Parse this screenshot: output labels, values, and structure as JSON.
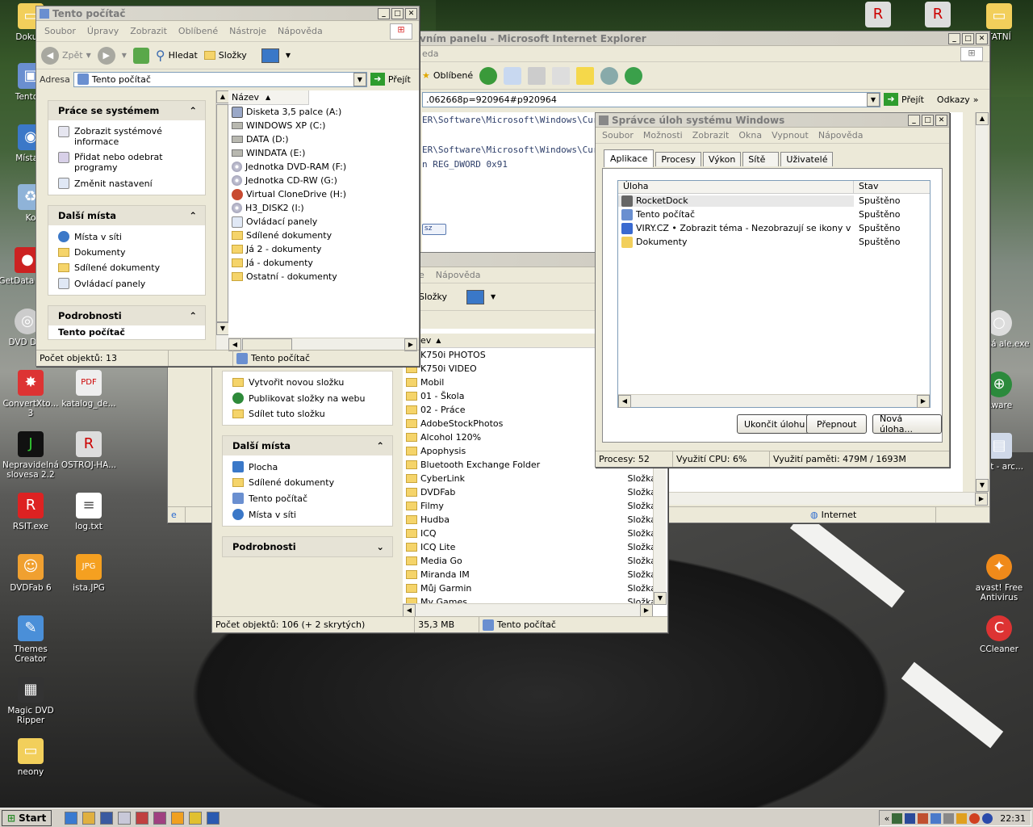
{
  "desktop": {
    "icons_left": [
      {
        "label": "Dokum",
        "icon": "folder-icon"
      },
      {
        "label": "Tento p",
        "icon": "computer-icon"
      },
      {
        "label": "Místa v",
        "icon": "network-icon"
      },
      {
        "label": "Ko",
        "icon": "recycle-bin-icon"
      },
      {
        "label": "GetData for F",
        "icon": "getdata-icon"
      },
      {
        "label": "DVD Dec",
        "icon": "dvd-icon"
      },
      {
        "label": "ConvertXto... 3",
        "icon": "convertx-icon"
      },
      {
        "label": "katalog_de...",
        "icon": "pdf-icon"
      },
      {
        "label": "Nepravidelná slovesa 2.2",
        "icon": "app-j-icon"
      },
      {
        "label": "OSTROJ-HA...",
        "icon": "rsit-doc-icon"
      },
      {
        "label": "RSIT.exe",
        "icon": "rsit-icon"
      },
      {
        "label": "log.txt",
        "icon": "text-file-icon"
      },
      {
        "label": "DVDFab 6",
        "icon": "dvdfab-icon"
      },
      {
        "label": "ista.JPG",
        "icon": "jpg-icon"
      },
      {
        "label": "Themes Creator",
        "icon": "themes-icon"
      },
      {
        "label": "Magic DVD Ripper",
        "icon": "film-icon"
      },
      {
        "label": "neony",
        "icon": "folder-icon"
      }
    ],
    "icons_right": [
      {
        "label": "TATNÍ",
        "icon": "folder-icon"
      },
      {
        "label": "štecká ale.exe",
        "icon": "app-icon"
      },
      {
        "label": "Aware",
        "icon": "adaware-icon"
      },
      {
        "label": "ybot - arc...",
        "icon": "spybot-icon"
      },
      {
        "label": "avast! Free Antivirus",
        "icon": "avast-icon"
      },
      {
        "label": "CCleaner",
        "icon": "ccleaner-icon"
      }
    ]
  },
  "ie_window": {
    "title": "vním panelu - Microsoft Internet Explorer",
    "menu_partial": "eda",
    "toolbar": {
      "favorites": "Oblíbené"
    },
    "address": ".062668p=920964#p920964",
    "go_label": "Přejít",
    "links_label": "Odkazy",
    "content_lines": [
      "ER\\Software\\Microsoft\\Windows\\Curr",
      "ER\\Software\\Microsoft\\Windows\\Curr",
      "n REG_DWORD 0x91"
    ],
    "small_button": "sz",
    "status_zone": "Internet"
  },
  "explorer_main": {
    "title": "Tento počítač",
    "menu": [
      "Soubor",
      "Úpravy",
      "Zobrazit",
      "Oblíbené",
      "Nástroje",
      "Nápověda"
    ],
    "toolbar": {
      "back": "Zpět",
      "search": "Hledat",
      "folders": "Složky"
    },
    "address_label": "Adresa",
    "address_value": "Tento počítač",
    "go_label": "Přejít",
    "column_name": "Název",
    "panels": {
      "system": {
        "title": "Práce se systémem",
        "items": [
          "Zobrazit systémové informace",
          "Přidat nebo odebrat programy",
          "Změnit nastavení"
        ]
      },
      "places": {
        "title": "Další místa",
        "items": [
          "Místa v síti",
          "Dokumenty",
          "Sdílené dokumenty",
          "Ovládací panely"
        ]
      },
      "details": {
        "title": "Podrobnosti",
        "subtitle": "Tento počítač"
      }
    },
    "items": [
      {
        "name": "Disketa 3,5 palce (A:)",
        "kind": "floppy"
      },
      {
        "name": "WINDOWS XP (C:)",
        "kind": "drive"
      },
      {
        "name": "DATA (D:)",
        "kind": "drive"
      },
      {
        "name": "WINDATA (E:)",
        "kind": "drive"
      },
      {
        "name": "Jednotka DVD-RAM (F:)",
        "kind": "cd"
      },
      {
        "name": "Jednotka CD-RW (G:)",
        "kind": "cd"
      },
      {
        "name": "Virtual CloneDrive (H:)",
        "kind": "clone"
      },
      {
        "name": "H3_DISK2 (I:)",
        "kind": "cd"
      },
      {
        "name": "Ovládací panely",
        "kind": "control"
      },
      {
        "name": "Sdílené dokumenty",
        "kind": "folder"
      },
      {
        "name": "Já 2 - dokumenty",
        "kind": "folder"
      },
      {
        "name": "Já - dokumenty",
        "kind": "folder"
      },
      {
        "name": "Ostatní - dokumenty",
        "kind": "folder"
      }
    ],
    "status": {
      "count": "Počet objektů: 13",
      "location": "Tento počítač"
    }
  },
  "explorer_second": {
    "menu_partial": [
      "e",
      "Nápověda"
    ],
    "toolbar": {
      "folders": "Složky"
    },
    "column_name": "ev",
    "file_tasks": [
      "Vytvořit novou složku",
      "Publikovat složky na webu",
      "Sdílet tuto složku"
    ],
    "places": {
      "title": "Další místa",
      "items": [
        "Plocha",
        "Sdílené dokumenty",
        "Tento počítač",
        "Místa v síti"
      ]
    },
    "details_title": "Podrobnosti",
    "items": [
      {
        "name": "K750i PHOTOS",
        "type": ""
      },
      {
        "name": "K750i VIDEO",
        "type": ""
      },
      {
        "name": "Mobil",
        "type": ""
      },
      {
        "name": "01 - Škola",
        "type": ""
      },
      {
        "name": "02 - Práce",
        "type": ""
      },
      {
        "name": "AdobeStockPhotos",
        "type": ""
      },
      {
        "name": "Alcohol 120%",
        "type": ""
      },
      {
        "name": "Apophysis",
        "type": ""
      },
      {
        "name": "Bluetooth Exchange Folder",
        "type": ""
      },
      {
        "name": "CyberLink",
        "type": "Složka"
      },
      {
        "name": "DVDFab",
        "type": "Složka"
      },
      {
        "name": "Filmy",
        "type": "Složka"
      },
      {
        "name": "Hudba",
        "type": "Složka"
      },
      {
        "name": "ICQ",
        "type": "Složka"
      },
      {
        "name": "ICQ Lite",
        "type": "Složka"
      },
      {
        "name": "Media Go",
        "type": "Složka"
      },
      {
        "name": "Miranda IM",
        "type": "Složka"
      },
      {
        "name": "Můj Garmin",
        "type": "Složka"
      },
      {
        "name": "My Games",
        "type": "Složka"
      }
    ],
    "status": {
      "count": "Počet objektů: 106 (+ 2 skrytých)",
      "size": "35,3 MB",
      "location": "Tento počítač"
    }
  },
  "task_manager": {
    "title": "Správce úloh systému Windows",
    "menu": [
      "Soubor",
      "Možnosti",
      "Zobrazit",
      "Okna",
      "Vypnout",
      "Nápověda"
    ],
    "tabs": [
      "Aplikace",
      "Procesy",
      "Výkon",
      "Sítě",
      "Uživatelé"
    ],
    "columns": [
      "Úloha",
      "Stav"
    ],
    "rows": [
      {
        "task": "RocketDock",
        "state": "Spuštěno"
      },
      {
        "task": "Tento počítač",
        "state": "Spuštěno"
      },
      {
        "task": "VIRY.CZ • Zobrazit téma - Nezobrazují se ikony v hlav...",
        "state": "Spuštěno"
      },
      {
        "task": "Dokumenty",
        "state": "Spuštěno"
      }
    ],
    "buttons": {
      "end": "Ukončit úlohu",
      "switch": "Přepnout",
      "new": "Nová úloha..."
    },
    "status": {
      "processes": "Procesy: 52",
      "cpu": "Využití CPU: 6%",
      "memory": "Využití paměti: 479M / 1693M"
    }
  },
  "taskbar": {
    "start": "Start",
    "clock": "22:31"
  }
}
